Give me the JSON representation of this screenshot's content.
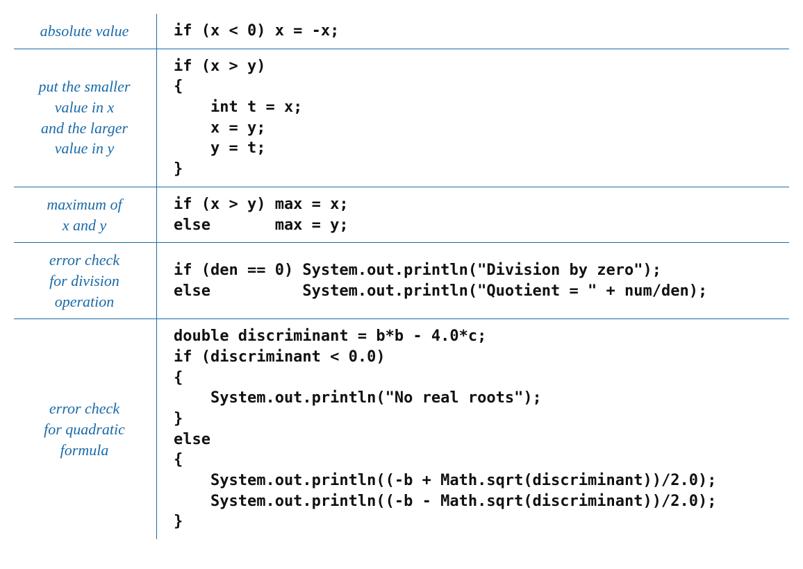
{
  "rows": [
    {
      "label": "absolute value",
      "code": "if (x < 0) x = -x;"
    },
    {
      "label": "put the smaller\nvalue in x\nand the larger\nvalue in y",
      "code": "if (x > y)\n{\n    int t = x;\n    x = y;\n    y = t;\n}"
    },
    {
      "label": "maximum of\nx and y",
      "code": "if (x > y) max = x;\nelse       max = y;"
    },
    {
      "label": "error check\nfor division\noperation",
      "code": "if (den == 0) System.out.println(\"Division by zero\");\nelse          System.out.println(\"Quotient = \" + num/den);"
    },
    {
      "label": "error check\nfor quadratic\nformula",
      "code": "double discriminant = b*b - 4.0*c;\nif (discriminant < 0.0)\n{\n    System.out.println(\"No real roots\");\n}\nelse\n{\n    System.out.println((-b + Math.sqrt(discriminant))/2.0);\n    System.out.println((-b - Math.sqrt(discriminant))/2.0);\n}"
    }
  ]
}
